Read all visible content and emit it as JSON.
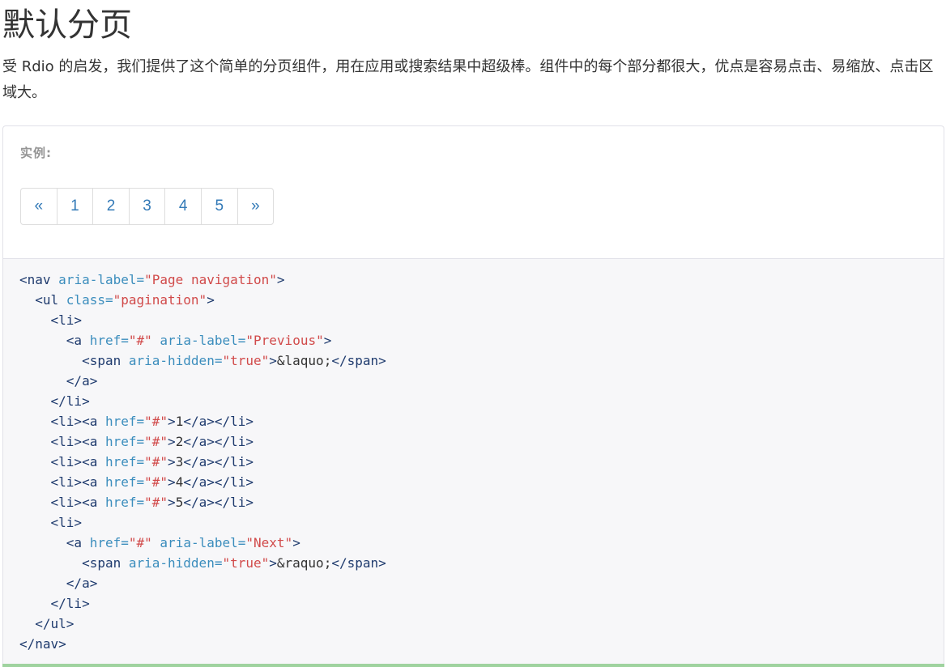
{
  "header": {
    "title": "默认分页",
    "intro": "受 Rdio 的启发，我们提供了这个简单的分页组件，用在应用或搜索结果中超级棒。组件中的每个部分都很大，优点是容易点击、易缩放、点击区域大。"
  },
  "example": {
    "label": "实例:",
    "pagination": {
      "prev": "«",
      "pages": [
        "1",
        "2",
        "3",
        "4",
        "5"
      ],
      "next": "»"
    }
  },
  "code": {
    "lines": [
      [
        {
          "c": "tg",
          "t": "<nav "
        },
        {
          "c": "at",
          "t": "aria-label="
        },
        {
          "c": "st",
          "t": "\"Page navigation\""
        },
        {
          "c": "tg",
          "t": ">"
        }
      ],
      [
        {
          "c": "tx",
          "t": "  "
        },
        {
          "c": "tg",
          "t": "<ul "
        },
        {
          "c": "at",
          "t": "class="
        },
        {
          "c": "st",
          "t": "\"pagination\""
        },
        {
          "c": "tg",
          "t": ">"
        }
      ],
      [
        {
          "c": "tx",
          "t": "    "
        },
        {
          "c": "tg",
          "t": "<li>"
        }
      ],
      [
        {
          "c": "tx",
          "t": "      "
        },
        {
          "c": "tg",
          "t": "<a "
        },
        {
          "c": "at",
          "t": "href="
        },
        {
          "c": "st",
          "t": "\"#\""
        },
        {
          "c": "tx",
          "t": " "
        },
        {
          "c": "at",
          "t": "aria-label="
        },
        {
          "c": "st",
          "t": "\"Previous\""
        },
        {
          "c": "tg",
          "t": ">"
        }
      ],
      [
        {
          "c": "tx",
          "t": "        "
        },
        {
          "c": "tg",
          "t": "<span "
        },
        {
          "c": "at",
          "t": "aria-hidden="
        },
        {
          "c": "st",
          "t": "\"true\""
        },
        {
          "c": "tg",
          "t": ">"
        },
        {
          "c": "tx",
          "t": "&laquo;"
        },
        {
          "c": "tg",
          "t": "</span>"
        }
      ],
      [
        {
          "c": "tx",
          "t": "      "
        },
        {
          "c": "tg",
          "t": "</a>"
        }
      ],
      [
        {
          "c": "tx",
          "t": "    "
        },
        {
          "c": "tg",
          "t": "</li>"
        }
      ],
      [
        {
          "c": "tx",
          "t": "    "
        },
        {
          "c": "tg",
          "t": "<li><a "
        },
        {
          "c": "at",
          "t": "href="
        },
        {
          "c": "st",
          "t": "\"#\""
        },
        {
          "c": "tg",
          "t": ">"
        },
        {
          "c": "tx",
          "t": "1"
        },
        {
          "c": "tg",
          "t": "</a></li>"
        }
      ],
      [
        {
          "c": "tx",
          "t": "    "
        },
        {
          "c": "tg",
          "t": "<li><a "
        },
        {
          "c": "at",
          "t": "href="
        },
        {
          "c": "st",
          "t": "\"#\""
        },
        {
          "c": "tg",
          "t": ">"
        },
        {
          "c": "tx",
          "t": "2"
        },
        {
          "c": "tg",
          "t": "</a></li>"
        }
      ],
      [
        {
          "c": "tx",
          "t": "    "
        },
        {
          "c": "tg",
          "t": "<li><a "
        },
        {
          "c": "at",
          "t": "href="
        },
        {
          "c": "st",
          "t": "\"#\""
        },
        {
          "c": "tg",
          "t": ">"
        },
        {
          "c": "tx",
          "t": "3"
        },
        {
          "c": "tg",
          "t": "</a></li>"
        }
      ],
      [
        {
          "c": "tx",
          "t": "    "
        },
        {
          "c": "tg",
          "t": "<li><a "
        },
        {
          "c": "at",
          "t": "href="
        },
        {
          "c": "st",
          "t": "\"#\""
        },
        {
          "c": "tg",
          "t": ">"
        },
        {
          "c": "tx",
          "t": "4"
        },
        {
          "c": "tg",
          "t": "</a></li>"
        }
      ],
      [
        {
          "c": "tx",
          "t": "    "
        },
        {
          "c": "tg",
          "t": "<li><a "
        },
        {
          "c": "at",
          "t": "href="
        },
        {
          "c": "st",
          "t": "\"#\""
        },
        {
          "c": "tg",
          "t": ">"
        },
        {
          "c": "tx",
          "t": "5"
        },
        {
          "c": "tg",
          "t": "</a></li>"
        }
      ],
      [
        {
          "c": "tx",
          "t": "    "
        },
        {
          "c": "tg",
          "t": "<li>"
        }
      ],
      [
        {
          "c": "tx",
          "t": "      "
        },
        {
          "c": "tg",
          "t": "<a "
        },
        {
          "c": "at",
          "t": "href="
        },
        {
          "c": "st",
          "t": "\"#\""
        },
        {
          "c": "tx",
          "t": " "
        },
        {
          "c": "at",
          "t": "aria-label="
        },
        {
          "c": "st",
          "t": "\"Next\""
        },
        {
          "c": "tg",
          "t": ">"
        }
      ],
      [
        {
          "c": "tx",
          "t": "        "
        },
        {
          "c": "tg",
          "t": "<span "
        },
        {
          "c": "at",
          "t": "aria-hidden="
        },
        {
          "c": "st",
          "t": "\"true\""
        },
        {
          "c": "tg",
          "t": ">"
        },
        {
          "c": "tx",
          "t": "&raquo;"
        },
        {
          "c": "tg",
          "t": "</span>"
        }
      ],
      [
        {
          "c": "tx",
          "t": "      "
        },
        {
          "c": "tg",
          "t": "</a>"
        }
      ],
      [
        {
          "c": "tx",
          "t": "    "
        },
        {
          "c": "tg",
          "t": "</li>"
        }
      ],
      [
        {
          "c": "tx",
          "t": "  "
        },
        {
          "c": "tg",
          "t": "</ul>"
        }
      ],
      [
        {
          "c": "tg",
          "t": "</nav>"
        }
      ]
    ]
  },
  "colors": {
    "link": "#337ab7",
    "tag": "#1f3b6e",
    "attribute": "#3b8dbd",
    "string": "#d14a4a",
    "code_background": "#f7f7f9",
    "accent_bar": "#9fd39f"
  }
}
